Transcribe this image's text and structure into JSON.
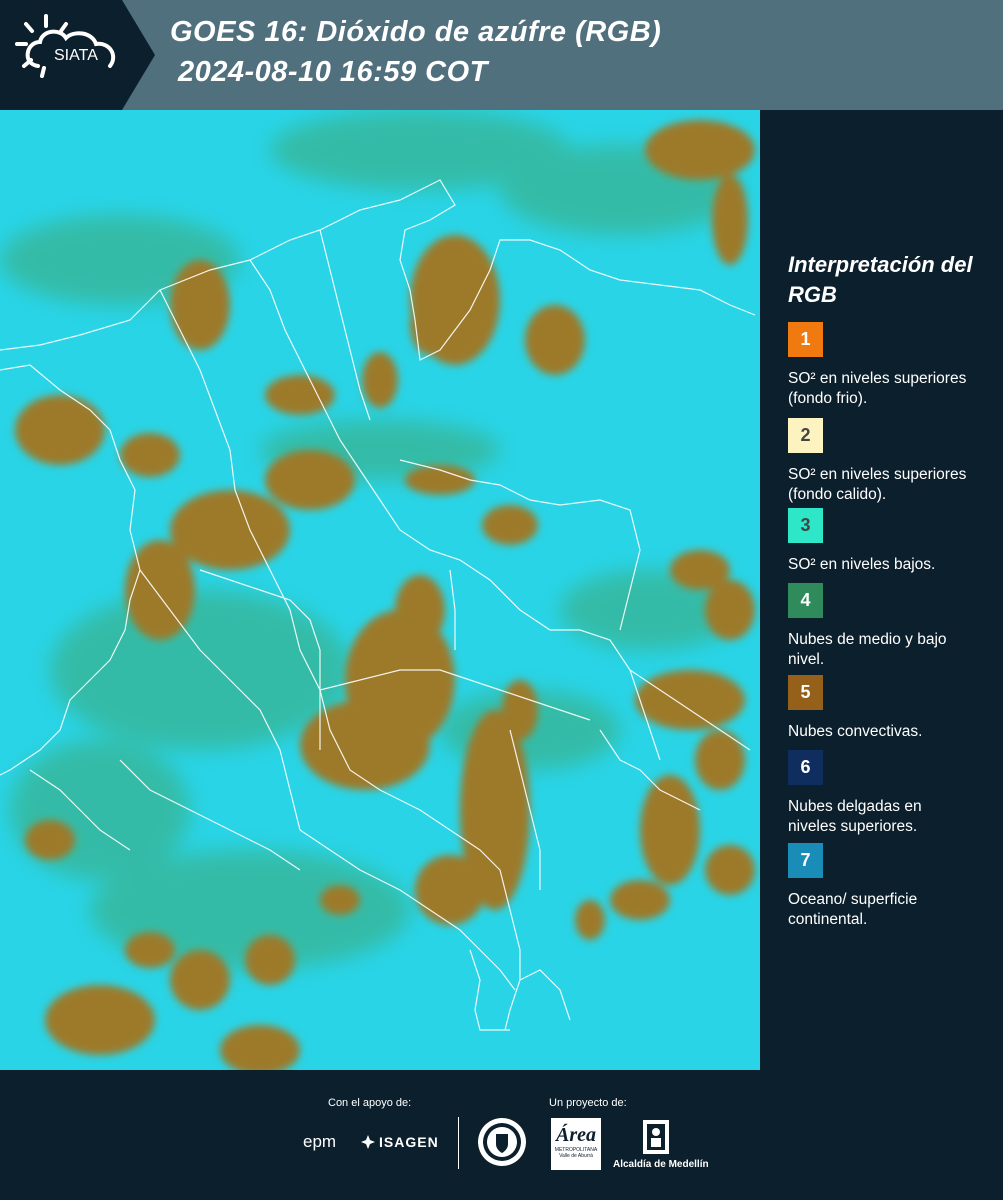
{
  "header": {
    "logo_text": "SIATA",
    "title_line1": "GOES 16: Dióxido de azúfre (RGB)",
    "title_line2": "2024-08-10 16:59 COT"
  },
  "map": {
    "description_icon": "satellite-rgb-map",
    "colors": {
      "background": "#29d4e6",
      "convective": "#9c7a2a",
      "mid_low": "#3a9a6a",
      "borders": "#ffffff"
    }
  },
  "legend": {
    "title": "Interpretación del RGB",
    "items": [
      {
        "number": "1",
        "color": "#f07a10",
        "text_color": "#ffffff",
        "label": "SO² en niveles superiores (fondo frio)."
      },
      {
        "number": "2",
        "color": "#fdf3c0",
        "text_color": "#444444",
        "label": "SO² en niveles superiores (fondo calido)."
      },
      {
        "number": "3",
        "color": "#2ee6c8",
        "text_color": "#444444",
        "label": "SO² en niveles bajos."
      },
      {
        "number": "4",
        "color": "#2f8a5c",
        "text_color": "#ffffff",
        "label": "Nubes de medio y bajo nivel."
      },
      {
        "number": "5",
        "color": "#95601a",
        "text_color": "#ffffff",
        "label": "Nubes convectivas."
      },
      {
        "number": "6",
        "color": "#0f2d5e",
        "text_color": "#ffffff",
        "label": "Nubes delgadas en niveles superiores."
      },
      {
        "number": "7",
        "color": "#1a8cb8",
        "text_color": "#ffffff",
        "label": "Oceano/ superficie continental."
      }
    ]
  },
  "footer": {
    "support_label": "Con el apoyo de:",
    "project_label": "Un proyecto de:",
    "sponsors": [
      "epm",
      "ISAGEN"
    ],
    "partners": [
      "Área Metropolitana Valle de Aburrá",
      "Alcaldía de Medellín"
    ],
    "area_logo_text": "Área",
    "area_logo_sub": "METROPOLITANA Valle de Aburrá",
    "alcaldia_text": "Alcaldía de Medellín"
  }
}
